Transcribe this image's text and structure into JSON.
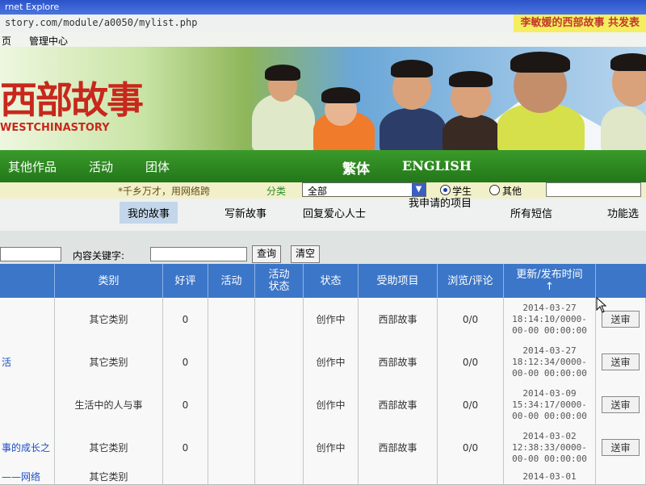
{
  "browser": {
    "title": "rnet Explore",
    "url": "story.com/module/a0050/mylist.php",
    "page_title": "李敏媛的西部故事 共发表"
  },
  "topnav": {
    "items": [
      "页",
      "管理中心"
    ]
  },
  "banner": {
    "logo": "西部故事",
    "logo_en": "WESTCHINASTORY"
  },
  "mainnav": {
    "items": [
      "其他作品",
      "活动",
      "团体"
    ],
    "traditional": "繁体",
    "english": "ENGLISH"
  },
  "filter": {
    "slogan": "*千乡万才，用网络跨",
    "category_label": "分类",
    "category_value": "全部",
    "radio_student": "学生",
    "radio_other": "其他"
  },
  "tabs": [
    "我的故事",
    "写新故事",
    "回复爱心人士",
    "我申请的项目",
    "所有短信",
    "功能选"
  ],
  "search": {
    "keyword_label": "内容关键字:",
    "search_btn": "查询",
    "clear_btn": "清空"
  },
  "table": {
    "headers": [
      "类别",
      "好评",
      "活动",
      "活动状态",
      "状态",
      "受助项目",
      "浏览/评论",
      "更新/发布时间↑"
    ],
    "rows": [
      {
        "title": "",
        "category": "其它类别",
        "rating": "0",
        "activity": "",
        "activity_status": "",
        "status": "创作中",
        "project": "西部故事",
        "views": "0/0",
        "updated": "2014-03-27 18:14:10/0000-00-00 00:00:00",
        "action": "送审"
      },
      {
        "title": "活",
        "category": "其它类别",
        "rating": "0",
        "activity": "",
        "activity_status": "",
        "status": "创作中",
        "project": "西部故事",
        "views": "0/0",
        "updated": "2014-03-27 18:12:34/0000-00-00 00:00:00",
        "action": "送审"
      },
      {
        "title": "",
        "category": "生活中的人与事",
        "rating": "0",
        "activity": "",
        "activity_status": "",
        "status": "创作中",
        "project": "西部故事",
        "views": "0/0",
        "updated": "2014-03-09 15:34:17/0000-00-00 00:00:00",
        "action": "送审"
      },
      {
        "title": "事的成长之",
        "category": "其它类别",
        "rating": "0",
        "activity": "",
        "activity_status": "",
        "status": "创作中",
        "project": "西部故事",
        "views": "0/0",
        "updated": "2014-03-02 12:38:33/0000-00-00 00:00:00",
        "action": "送审"
      },
      {
        "title": "——网络",
        "category": "其它类别",
        "rating": "",
        "activity": "",
        "activity_status": "",
        "status": "",
        "project": "",
        "views": "",
        "updated": "2014-03-01",
        "action": ""
      }
    ]
  },
  "colors": {
    "nav_green": "#2e8b22",
    "header_blue": "#3c76c8",
    "logo_red": "#c7281d",
    "filter_bg": "#f1f0c8"
  }
}
